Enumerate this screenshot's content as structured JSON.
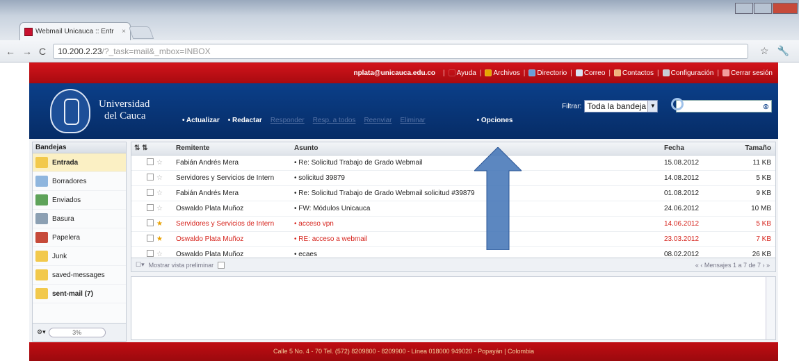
{
  "browser": {
    "tab_title": "Webmail Unicauca :: Entr",
    "url_host": "10.200.2.23",
    "url_path": "/?_task=mail&_mbox=INBOX"
  },
  "topbar": {
    "user": "nplata@unicauca.edu.co",
    "links": [
      "Ayuda",
      "Archivos",
      "Directorio",
      "Correo",
      "Contactos",
      "Configuración",
      "Cerrar sesión"
    ]
  },
  "header": {
    "uni_line1": "Universidad",
    "uni_line2": "del Cauca",
    "menu": [
      "Actualizar",
      "Redactar",
      "Responder",
      "Resp. a todos",
      "Reenviar",
      "Eliminar"
    ],
    "menu_opciones": "Opciones",
    "filter_label": "Filtrar:",
    "filter_value": "Toda la bandeja"
  },
  "sidebar": {
    "title": "Bandejas",
    "folders": [
      {
        "label": "Entrada",
        "icon": "inbox-icon",
        "color": "#f2c94c"
      },
      {
        "label": "Borradores",
        "icon": "drafts-icon",
        "color": "#8fb6de"
      },
      {
        "label": "Enviados",
        "icon": "sent-icon",
        "color": "#5ea35a"
      },
      {
        "label": "Basura",
        "icon": "junk-bin-icon",
        "color": "#8ca0b3"
      },
      {
        "label": "Papelera",
        "icon": "trash-icon",
        "color": "#c64a3a"
      },
      {
        "label": "Junk",
        "icon": "folder-icon",
        "color": "#f2c94c"
      },
      {
        "label": "saved-messages",
        "icon": "folder-icon",
        "color": "#f2c94c"
      },
      {
        "label": "sent-mail (7)",
        "icon": "folder-icon",
        "color": "#f2c94c"
      }
    ],
    "quota": "3%"
  },
  "list": {
    "columns": {
      "from": "Remitente",
      "subject": "Asunto",
      "date": "Fecha",
      "size": "Tamaño"
    },
    "rows": [
      {
        "from": "Fabián Andrés Mera",
        "subject": "Re: Solicitud Trabajo de Grado Webmail",
        "date": "15.08.2012",
        "size": "11 KB",
        "flagged": false
      },
      {
        "from": "Servidores y Servicios de Intern",
        "subject": "solicitud 39879",
        "date": "14.08.2012",
        "size": "5 KB",
        "flagged": false
      },
      {
        "from": "Fabián Andrés Mera",
        "subject": "Re: Solicitud Trabajo de Grado Webmail solicitud #39879",
        "date": "01.08.2012",
        "size": "9 KB",
        "flagged": false
      },
      {
        "from": "Oswaldo Plata Muñoz",
        "subject": "FW: Módulos Unicauca",
        "date": "24.06.2012",
        "size": "10 MB",
        "flagged": false
      },
      {
        "from": "Servidores y Servicios de Intern",
        "subject": "acceso vpn",
        "date": "14.06.2012",
        "size": "5 KB",
        "flagged": true
      },
      {
        "from": "Oswaldo Plata Muñoz",
        "subject": "RE: acceso a webmail",
        "date": "23.03.2012",
        "size": "7 KB",
        "flagged": true
      },
      {
        "from": "Oswaldo Plata Muñoz",
        "subject": "ecaes",
        "date": "08.02.2012",
        "size": "26 KB",
        "flagged": false
      }
    ],
    "footer_left": "Mostrar vista preliminar",
    "footer_right": "Mensajes 1 a 7 de 7"
  },
  "footer": {
    "text": "Calle 5 No. 4 - 70 Tel. (572) 8209800 - 8209900 - Línea 018000 949020 - Popayán | Colombia"
  },
  "colors": {
    "brand_red": "#c00c12",
    "brand_blue": "#0b3f89",
    "arrow_blue": "#3f72b5"
  }
}
